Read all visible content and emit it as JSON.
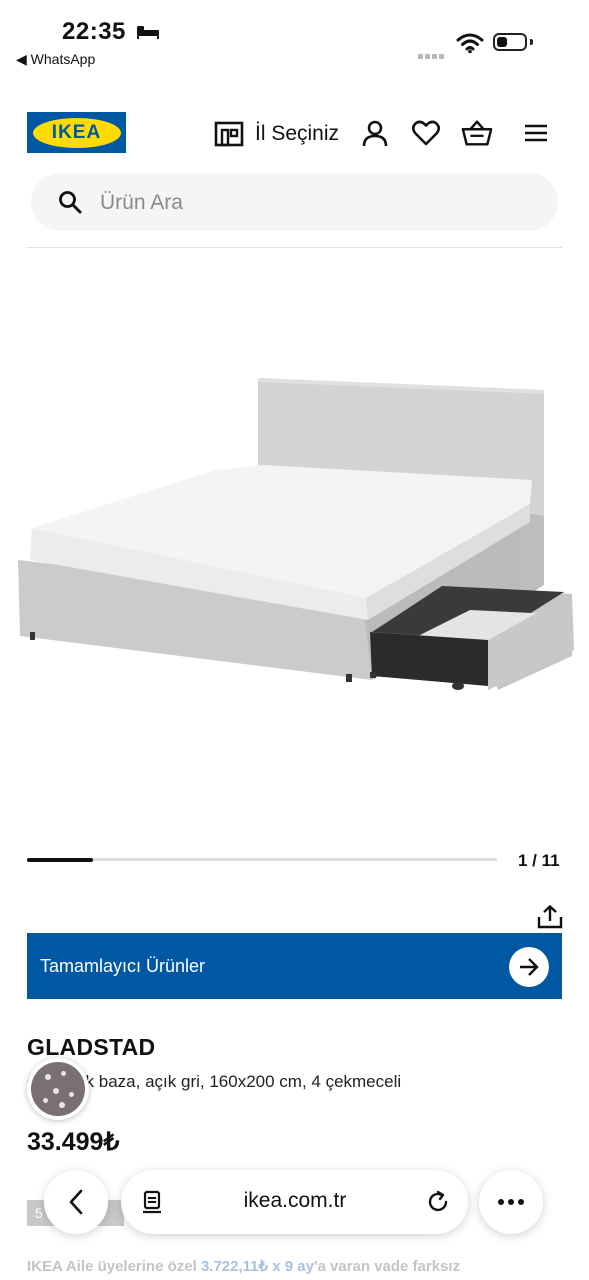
{
  "status_bar": {
    "time": "22:35",
    "back_app": "◀ WhatsApp",
    "battery_level": 0.3
  },
  "header": {
    "logo_text": "IKEA",
    "store_label": "İl Seçiniz",
    "brand_blue": "#0058A3",
    "brand_yellow": "#FFDB00"
  },
  "search": {
    "placeholder": "Ürün Ara"
  },
  "gallery": {
    "current": 1,
    "total": 11,
    "counter_text": "1 / 11",
    "progress": 0.14
  },
  "banner": {
    "label": "Tamamlayıcı Ürünler"
  },
  "product": {
    "name": "GLADSTAD",
    "description": "çift kişilik baza, açık gri, 160x200 cm, 4 çekmeceli",
    "price": "33.499₺",
    "badge": "5 2",
    "family_prefix": "IKEA Aile üyelerine özel ",
    "family_amount": "3.722,11₺ x 9 ay",
    "family_suffix": "'a varan vade farksız"
  },
  "browser": {
    "url": "ikea.com.tr"
  },
  "icons": [
    "bed-icon",
    "wifi-icon",
    "store-icon",
    "user-icon",
    "heart-icon",
    "basket-icon",
    "menu-icon",
    "search-icon",
    "share-icon",
    "arrow-right-icon",
    "cookie-icon",
    "back-chevron-icon",
    "tabs-icon",
    "reload-icon",
    "more-icon"
  ]
}
